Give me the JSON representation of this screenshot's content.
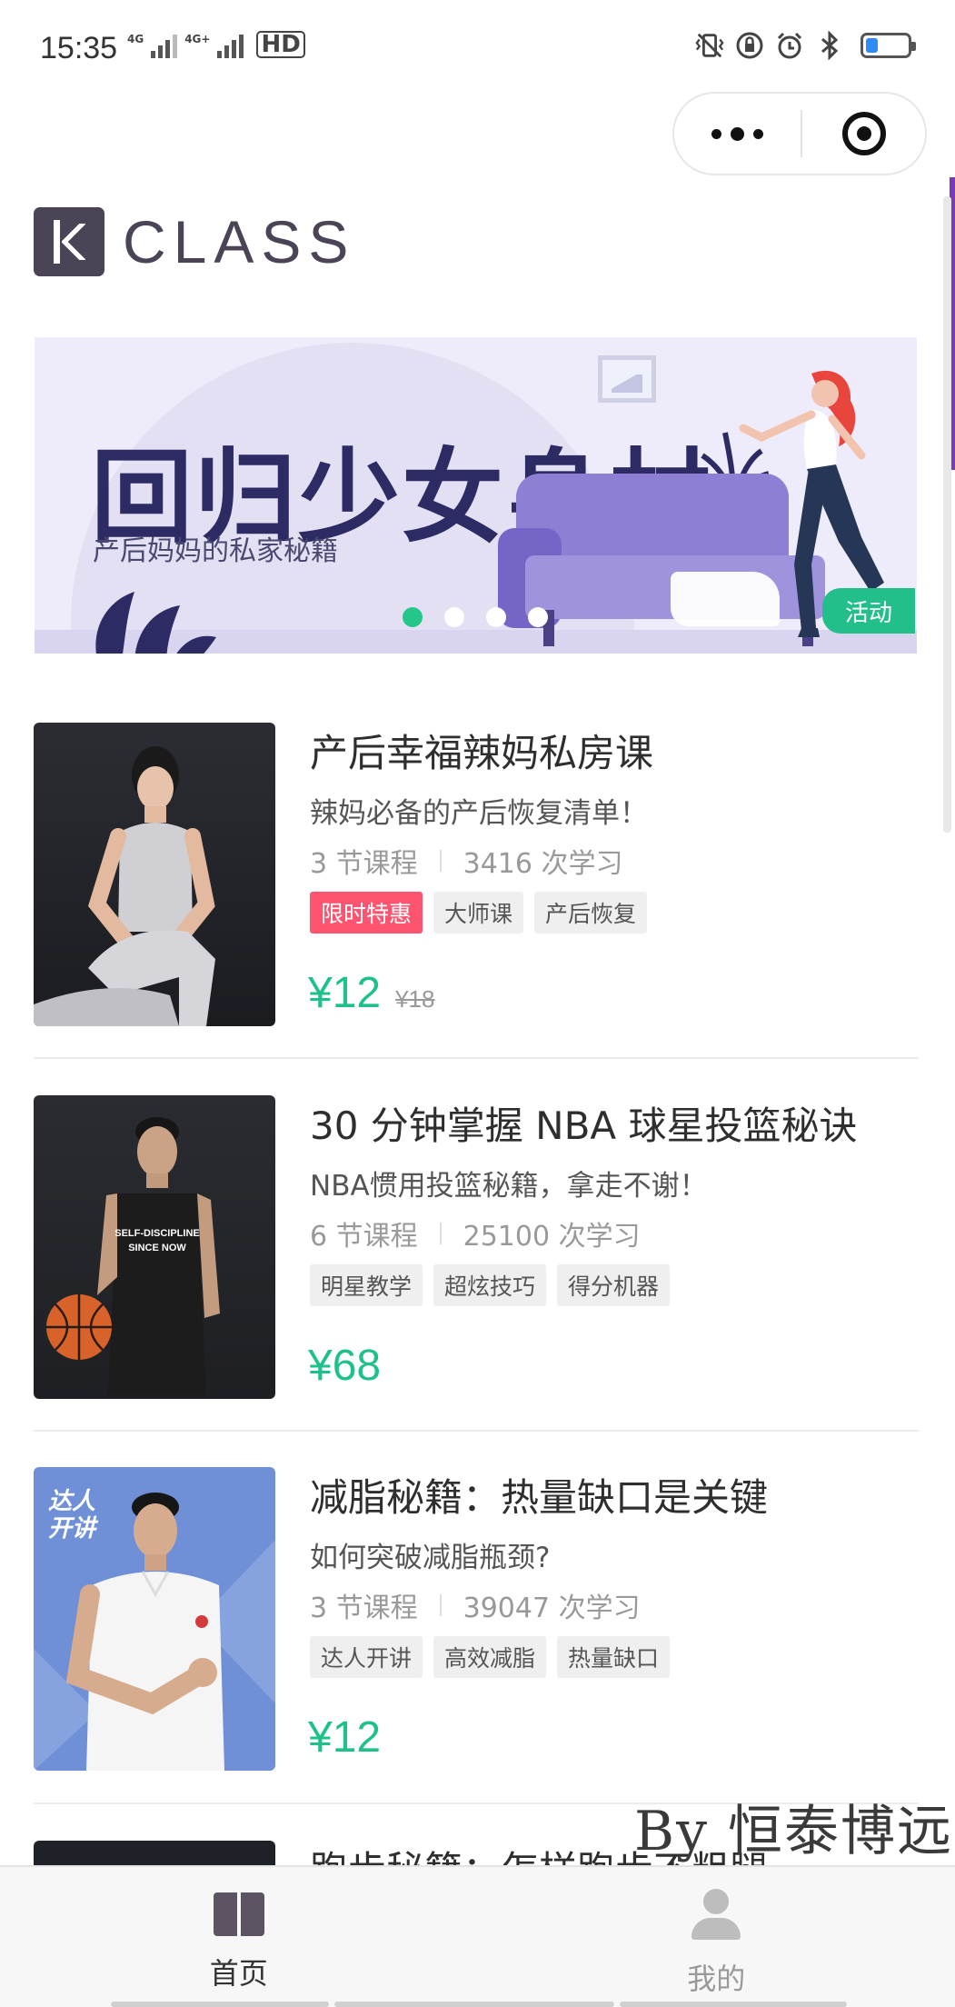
{
  "status_bar": {
    "time": "15:35",
    "network_1": "4G",
    "network_2": "4G+",
    "hd": "HD",
    "battery_level": 0.3,
    "icons": [
      "vibrate-icon",
      "rotation-lock-icon",
      "alarm-icon",
      "bluetooth-icon",
      "battery-icon"
    ]
  },
  "capsule": {
    "more_icon": "more-dots-icon",
    "close_icon": "target-close-icon"
  },
  "logo": {
    "text": "CLASS"
  },
  "banner": {
    "title": "回归少女身材",
    "subtitle": "产后妈妈的私家秘籍",
    "badge": "活动",
    "slide_count": 4,
    "active_slide": 0
  },
  "courses": [
    {
      "title": "产后幸福辣妈私房课",
      "desc": "辣妈必备的产后恢复清单！",
      "lessons": "3 节课程",
      "learners": "3416 次学习",
      "tags": [
        "限时特惠",
        "大师课",
        "产后恢复"
      ],
      "price": "¥12",
      "original_price": "¥18"
    },
    {
      "title": "30 分钟掌握 NBA 球星投篮秘诀",
      "desc": "NBA惯用投篮秘籍，拿走不谢！",
      "lessons": "6 节课程",
      "learners": "25100 次学习",
      "tags": [
        "明星教学",
        "超炫技巧",
        "得分机器"
      ],
      "price": "¥68",
      "jersey_text_1": "SELF-DISCIPLINE",
      "jersey_text_2": "SINCE NOW"
    },
    {
      "title": "减脂秘籍：热量缺口是关键",
      "desc": "如何突破减脂瓶颈?",
      "lessons": "3 节课程",
      "learners": "39047 次学习",
      "tags": [
        "达人开讲",
        "高效减脂",
        "热量缺口"
      ],
      "price": "¥12",
      "thumb_label_1": "达人",
      "thumb_label_2": "开讲"
    },
    {
      "title": "跑步秘籍：怎样跑步不粗腿"
    }
  ],
  "watermark": "By  恒泰博远",
  "tabbar": {
    "items": [
      {
        "label": "首页",
        "icon": "book-icon",
        "active": true
      },
      {
        "label": "我的",
        "icon": "user-icon",
        "active": false
      }
    ]
  },
  "colors": {
    "accent_green": "#1ec08b",
    "hot_tag": "#ff5470",
    "logo": "#4b4356",
    "banner_title": "#2d2b63"
  }
}
